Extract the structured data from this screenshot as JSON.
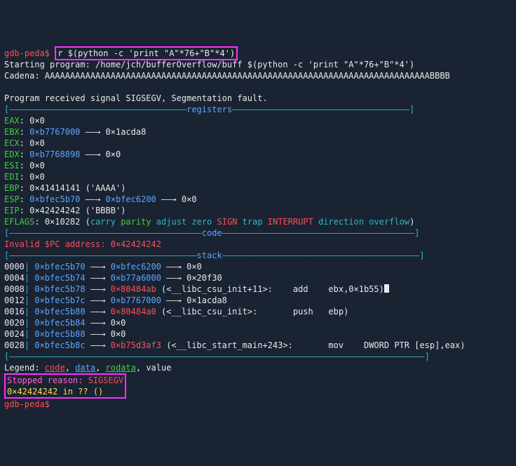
{
  "prompt": "gdb-peda$ ",
  "cmd": "r $(python -c 'print \"A\"*76+\"B\"*4')",
  "starting": "Starting program: /home/jch/bufferOverflow/buff $(python -c 'print \"A\"*76+\"B\"*4')",
  "cadena_label": "Cadena:",
  "cadena_val": " AAAAAAAAAAAAAAAAAAAAAAAAAAAAAAAAAAAAAAAAAAAAAAAAAAAAAAAAAAAAAAAAAAAAAAAAAAAABBBB",
  "signal": "Program received signal SIGSEGV, Segmentation fault.",
  "hr_registers": {
    "left": "[———————————————————————————————————",
    "label": "registers",
    "right": "———————————————————————————————————]"
  },
  "reg": {
    "eax": {
      "name": "EAX",
      "val": "0×0"
    },
    "ebx": {
      "name": "EBX",
      "val": "0×b7767000",
      "arrow": " ——→ ",
      "tgt": "0×1acda8"
    },
    "ecx": {
      "name": "ECX",
      "val": "0×0"
    },
    "edx": {
      "name": "EDX",
      "val": "0×b7768898",
      "arrow": " ——→ ",
      "tgt": "0×0"
    },
    "esi": {
      "name": "ESI",
      "val": "0×0"
    },
    "edi": {
      "name": "EDI",
      "val": "0×0"
    },
    "ebp": {
      "name": "EBP",
      "val": "0×41414141",
      "note": " ('AAAA')"
    },
    "esp": {
      "name": "ESP",
      "val": "0×bfec5b70",
      "arrow": " ——→ ",
      "mid": "0×bfec6200",
      "arrow2": " ——→ ",
      "tgt": "0×0"
    },
    "eip": {
      "name": "EIP",
      "val": "0×42424242",
      "note": " ('BBBB')"
    },
    "eflags": {
      "name": "EFLAGS",
      "val": "0×10282",
      "open": " (",
      "w1": "carry ",
      "w2": "parity",
      "sp1": " ",
      "w3": "adjust ",
      "w4": "zero ",
      "w5": "SIGN",
      "sp2": " ",
      "w6": "trap ",
      "w7": "INTERRUPT",
      "sp3": " ",
      "w8": "direction ",
      "w9": "overflow",
      "close": ")"
    }
  },
  "hr_code": {
    "left": "[——————————————————————————————————————",
    "label": "code",
    "right": "——————————————————————————————————————]"
  },
  "invalid_pc": "Invalid $PC address: 0×42424242",
  "hr_stack": {
    "left": "[—————————————————————————————————————",
    "label": "stack",
    "right": "———————————————————————————————————————]"
  },
  "stack": [
    {
      "off": "0000",
      "bar": "| ",
      "addr": "0×bfec5b70",
      "arrow": " ——→ ",
      "mid": "0×bfec6200",
      "arrow2": " ——→ ",
      "tgt": "0×0"
    },
    {
      "off": "0004",
      "bar": "| ",
      "addr": "0×bfec5b74",
      "arrow": " ——→ ",
      "mid": "0×b77a6000",
      "arrow2": " ——→ ",
      "tgt": "0×20f30"
    },
    {
      "off": "0008",
      "bar": "| ",
      "addr": "0×bfec5b78",
      "arrow": " ——→ ",
      "mid": "0×80484ab",
      "note": " (<__libc_csu_init+11>:    add    ebx,0×1b55)"
    },
    {
      "off": "0012",
      "bar": "| ",
      "addr": "0×bfec5b7c",
      "arrow": " ——→ ",
      "mid": "0×b7767000",
      "arrow2": " ——→ ",
      "tgt": "0×1acda8"
    },
    {
      "off": "0016",
      "bar": "| ",
      "addr": "0×bfec5b80",
      "arrow": " ——→ ",
      "mid": "0×80484a0",
      "note": " (<__libc_csu_init>:       push   ebp)"
    },
    {
      "off": "0020",
      "bar": "| ",
      "addr": "0×bfec5b84",
      "arrow": " ——→ ",
      "tgt": "0×0"
    },
    {
      "off": "0024",
      "bar": "| ",
      "addr": "0×bfec5b88",
      "arrow": " ——→ ",
      "tgt": "0×0"
    },
    {
      "off": "0028",
      "bar": "| ",
      "addr": "0×bfec5b8c",
      "arrow": " ——→ ",
      "mid": "0×b75d3af3",
      "note": " (<__libc_start_main+243>:       mov    DWORD PTR [esp],eax)"
    }
  ],
  "hr_end": "[——————————————————————————————————————————————————————————————————————————————————]",
  "legend": {
    "pre": "Legend: ",
    "code": "code",
    "sep1": ", ",
    "data": "data",
    "sep2": ", ",
    "rodata": "rodata",
    "sep3": ", value"
  },
  "stopped": {
    "pre": "Stopped reason: ",
    "reason": "SIGSEGV"
  },
  "bt": "0×42424242 in ?? ()",
  "prompt2": "gdb-peda$ "
}
